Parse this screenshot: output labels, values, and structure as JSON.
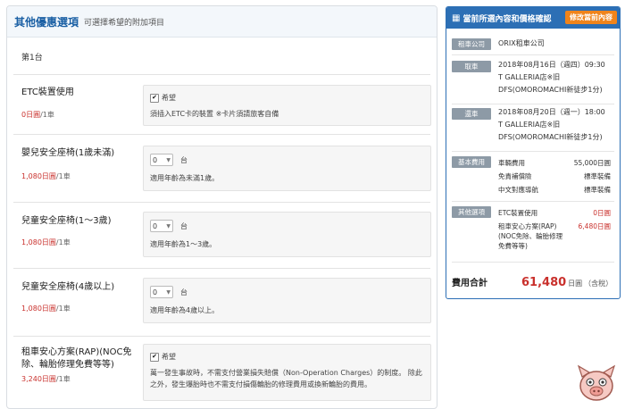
{
  "left": {
    "title": "其他優惠選項",
    "subtitle": "可選擇希望的附加項目",
    "car_label": "第1台",
    "options": [
      {
        "name": "ETC裝置使用",
        "price": "0日圓",
        "per": "/1車",
        "control": "checkbox",
        "check_label": "希望",
        "desc": "須插入ETC卡的裝置 ※卡片須請旅客自備"
      },
      {
        "name": "嬰兒安全座椅(1歲未滿)",
        "price": "1,080日圓",
        "per": "/1車",
        "control": "select",
        "value": "0",
        "unit": "台",
        "desc": "適用年齡為未滿1歲。"
      },
      {
        "name": "兒童安全座椅(1～3歲)",
        "price": "1,080日圓",
        "per": "/1車",
        "control": "select",
        "value": "0",
        "unit": "台",
        "desc": "適用年齡為1～3歲。"
      },
      {
        "name": "兒童安全座椅(4歲以上)",
        "price": "1,080日圓",
        "per": "/1車",
        "control": "select",
        "value": "0",
        "unit": "台",
        "desc": "適用年齡為4歲以上。"
      },
      {
        "name": "租車安心方案(RAP)(NOC免除、輪胎修理免費等等)",
        "price": "3,240日圓",
        "per": "/1車",
        "control": "checkbox",
        "check_label": "希望",
        "desc": "萬一發生事故時，不需支付營業損失賠償（Non-Operation Charges）的制度。 除此之外，發生爆胎時也不需支付損傷輪胎的修理費用或換新輪胎的費用。"
      }
    ]
  },
  "right": {
    "title": "當前所選內容和價格確認",
    "edit_label": "修改當前內容",
    "company_tag": "租車公司",
    "company": "ORIX租車公司",
    "pickup_tag": "取車",
    "pickup_lines": [
      "2018年08月16日（週四）09:30",
      "T GALLERIA店※旧",
      "DFS(OMOROMACHI新徒步1分)"
    ],
    "return_tag": "還車",
    "return_lines": [
      "2018年08月20日（週一）18:00",
      "T GALLERIA店※旧",
      "DFS(OMOROMACHI新徒步1分)"
    ],
    "basic_tag": "基本費用",
    "basic_items": [
      {
        "label": "車輛費用",
        "value": "55,000日圓"
      },
      {
        "label": "免責補償險",
        "value": "標準裝備"
      },
      {
        "label": "中文對應導航",
        "value": "標準裝備"
      }
    ],
    "other_tag": "其他選項",
    "other_items": [
      {
        "label": "ETC裝置使用",
        "value": "0日圓"
      },
      {
        "label": "租車安心方案(RAP)(NOC免除、輪胎修理免費等等)",
        "value": "6,480日圓"
      }
    ],
    "total_label": "費用合計",
    "total_amount": "61,480",
    "total_unit": "日圓",
    "total_tax": "（含稅）"
  },
  "icons": {
    "calendar": "calendar-icon",
    "check": "check-icon",
    "caret": "chevron-down-icon",
    "mascot": "mascot-icon"
  },
  "colors": {
    "accent": "#2c6fb5",
    "button": "#f0841b",
    "price": "#c9302c",
    "tag": "#8d9aa6"
  }
}
